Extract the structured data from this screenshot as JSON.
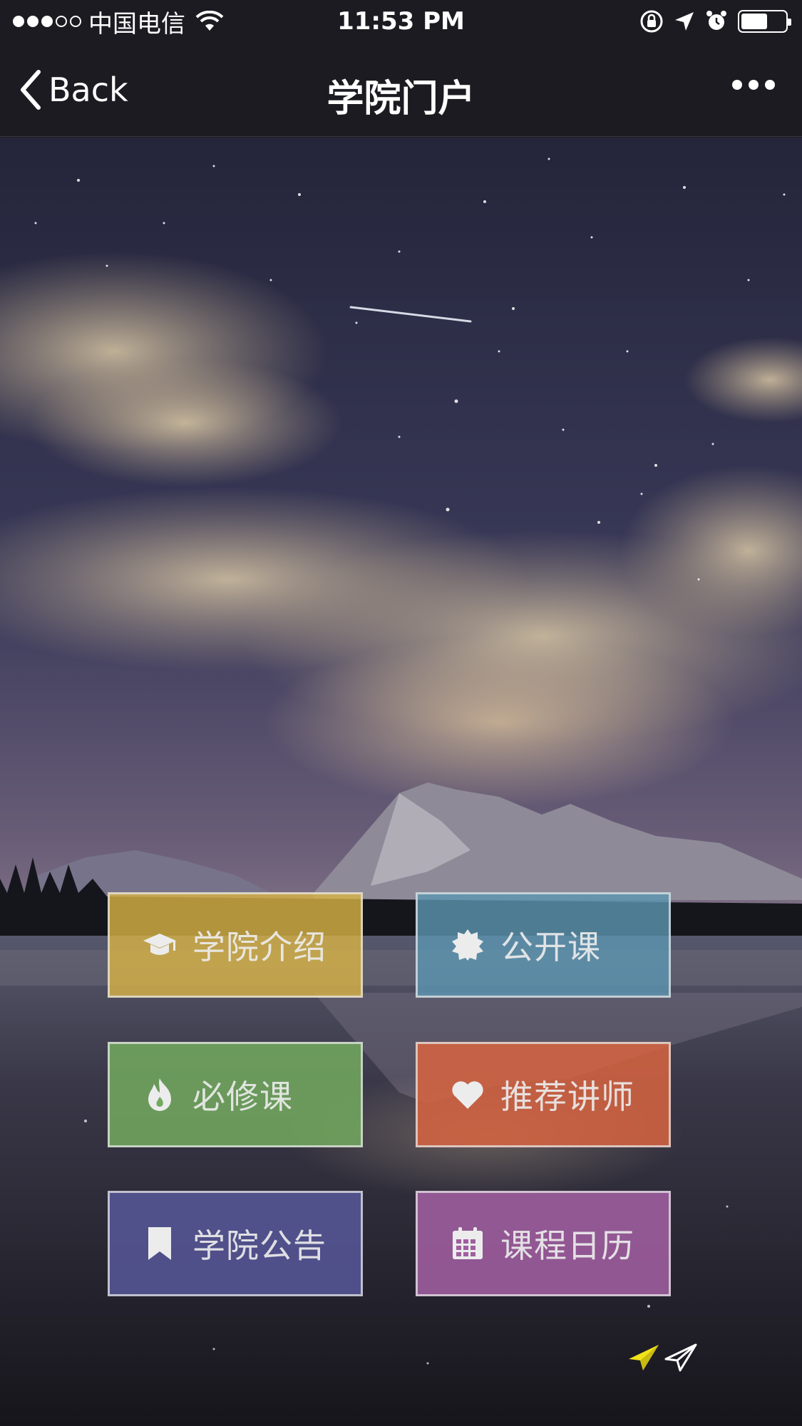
{
  "status_bar": {
    "carrier": "中国电信",
    "time": "11:53 PM",
    "signal_bars_filled": 3,
    "signal_bars_total": 5,
    "battery_level": 0.6
  },
  "nav": {
    "back_label": "Back",
    "title": "学院门户"
  },
  "tiles": [
    {
      "label": "学院介绍",
      "icon": "graduation-cap-icon",
      "color": "#DAB446"
    },
    {
      "label": "公开课",
      "icon": "badge-icon",
      "color": "#5C96B2"
    },
    {
      "label": "必修课",
      "icon": "fire-icon",
      "color": "#73AA5F"
    },
    {
      "label": "推荐讲师",
      "icon": "heart-icon",
      "color": "#D76441"
    },
    {
      "label": "学院公告",
      "icon": "bookmark-icon",
      "color": "#555596"
    },
    {
      "label": "课程日历",
      "icon": "calendar-icon",
      "color": "#A05FA0"
    }
  ],
  "footer_icons": [
    "paper-plane-yellow-icon",
    "paper-plane-white-icon"
  ]
}
